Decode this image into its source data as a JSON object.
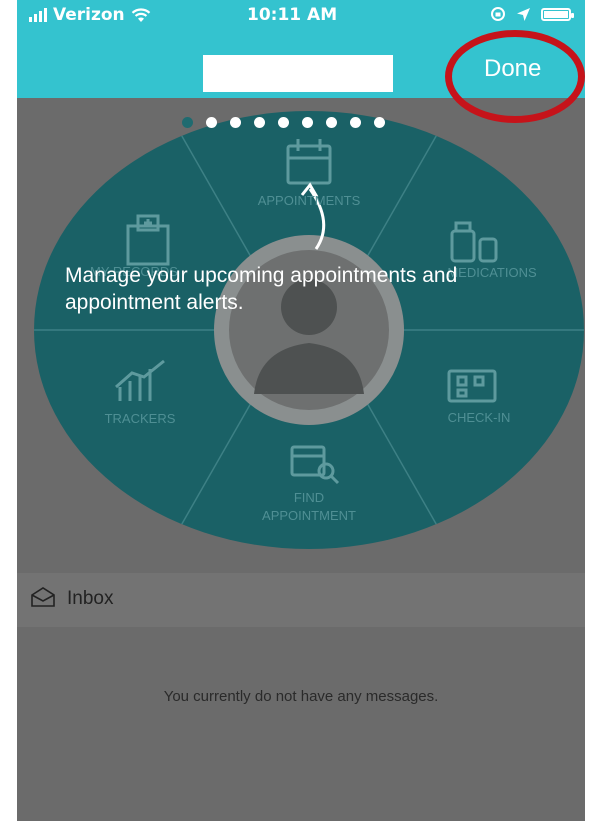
{
  "status": {
    "carrier": "Verizon",
    "time": "10:11 AM"
  },
  "nav": {
    "done_label": "Done"
  },
  "carousel": {
    "page_count": 9,
    "active_index": 0
  },
  "wheel": {
    "segments": [
      {
        "label": "APPOINTMENTS",
        "icon": "calendar-icon"
      },
      {
        "label": "MEDICATIONS",
        "icon": "medication-bottles-icon"
      },
      {
        "label": "CHECK-IN",
        "icon": "qr-ticket-icon"
      },
      {
        "label_line1": "FIND",
        "label_line2": "APPOINTMENT",
        "icon": "calendar-search-icon"
      },
      {
        "label": "TRACKERS",
        "icon": "chart-trend-icon"
      },
      {
        "label": "MY RECORDS",
        "icon": "hospital-icon"
      }
    ],
    "colors": {
      "wheel": "#1a6166",
      "segment_text": "#4f8f94"
    }
  },
  "tooltip": {
    "text": "Manage your upcoming appointments and appointment alerts."
  },
  "inbox": {
    "title": "Inbox",
    "empty_message": "You currently do not have any messages."
  },
  "colors": {
    "header": "#34c3cf",
    "overlay": "#6b6b6b",
    "highlight_ring": "#c6131a"
  }
}
